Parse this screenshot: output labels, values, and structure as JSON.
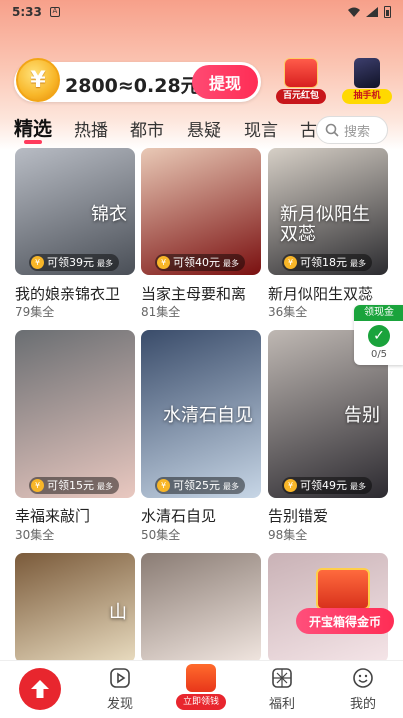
{
  "status_bar": {
    "time": "5:33"
  },
  "coin_bar": {
    "balance_text": "2800≈0.28元",
    "withdraw_label": "提现"
  },
  "promos": [
    {
      "label": "百元红包"
    },
    {
      "label": "抽手机"
    }
  ],
  "tabs": [
    {
      "label": "精选",
      "active": true
    },
    {
      "label": "热播"
    },
    {
      "label": "都市"
    },
    {
      "label": "悬疑"
    },
    {
      "label": "现言"
    },
    {
      "label": "古"
    }
  ],
  "search": {
    "placeholder": "搜索"
  },
  "dramas": [
    {
      "title": "我的娘亲锦衣卫",
      "episodes": "79集全",
      "reward": "可领39元",
      "reward_tag": "最多",
      "overlay": "锦衣",
      "colors": [
        "#4a4f57",
        "#b8bcc4"
      ]
    },
    {
      "title": "当家主母要和离",
      "episodes": "81集全",
      "reward": "可领40元",
      "reward_tag": "最多",
      "overlay": "",
      "colors": [
        "#7a1010",
        "#e9c9b6"
      ]
    },
    {
      "title": "新月似阳生双蕊",
      "episodes": "36集全",
      "reward": "可领18元",
      "reward_tag": "最多",
      "overlay": "新月似阳生双蕊",
      "colors": [
        "#2b2b2f",
        "#d6cfc6"
      ]
    },
    {
      "title": "幸福来敲门",
      "episodes": "30集全",
      "reward": "可领15元",
      "reward_tag": "最多",
      "overlay": "",
      "colors": [
        "#e9c8c0",
        "#6a6e72"
      ]
    },
    {
      "title": "水清石自见",
      "episodes": "50集全",
      "reward": "可领25元",
      "reward_tag": "最多",
      "overlay": "水清石自见",
      "colors": [
        "#c7d6e6",
        "#3a4c6a"
      ]
    },
    {
      "title": "告别错爱",
      "episodes": "98集全",
      "reward": "可领49元",
      "reward_tag": "最多",
      "overlay": "告别",
      "colors": [
        "#2c2a30",
        "#bfb8b3"
      ]
    },
    {
      "title": "",
      "episodes": "",
      "reward": "",
      "reward_tag": "",
      "overlay": "山",
      "colors": [
        "#e9dcc0",
        "#7a5a3a"
      ]
    },
    {
      "title": "",
      "episodes": "",
      "reward": "",
      "reward_tag": "",
      "overlay": "",
      "colors": [
        "#f1e6e0",
        "#8a7c74"
      ]
    },
    {
      "title": "",
      "episodes": "",
      "reward": "",
      "reward_tag": "",
      "overlay": "",
      "colors": [
        "#f5e5e8",
        "#c9b2b6"
      ]
    }
  ],
  "float_widget": {
    "title": "领现金",
    "progress": "0/5"
  },
  "treasure": {
    "label": "开宝箱得金币"
  },
  "bottom_nav": {
    "discover": "发现",
    "claim": "立即领钱",
    "welfare": "福利",
    "mine": "我的"
  }
}
